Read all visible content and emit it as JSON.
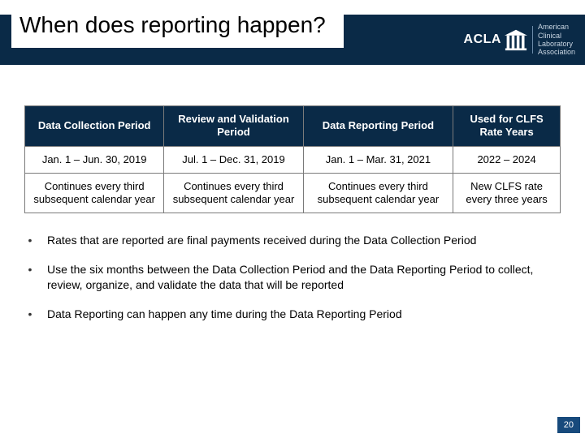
{
  "header": {
    "title": "When does reporting happen?",
    "logo": {
      "mark": "ACLA",
      "subtitle_line1": "American",
      "subtitle_line2": "Clinical",
      "subtitle_line3": "Laboratory",
      "subtitle_line4": "Association"
    }
  },
  "table": {
    "headers": [
      "Data Collection Period",
      "Review and Validation Period",
      "Data Reporting Period",
      "Used for CLFS Rate Years"
    ],
    "rows": [
      [
        "Jan. 1 – Jun. 30, 2019",
        "Jul. 1 – Dec. 31, 2019",
        "Jan. 1 – Mar. 31, 2021",
        "2022 – 2024"
      ],
      [
        "Continues every third subsequent calendar year",
        "Continues every third subsequent calendar year",
        "Continues every third subsequent calendar year",
        "New CLFS rate every three years"
      ]
    ]
  },
  "bullets": [
    "Rates that are reported are final payments received during the Data Collection Period",
    "Use the six months between the Data Collection Period and the Data Reporting Period to collect, review, organize, and validate the data that will be reported",
    "Data Reporting can happen any time during the Data Reporting Period"
  ],
  "page_number": "20"
}
